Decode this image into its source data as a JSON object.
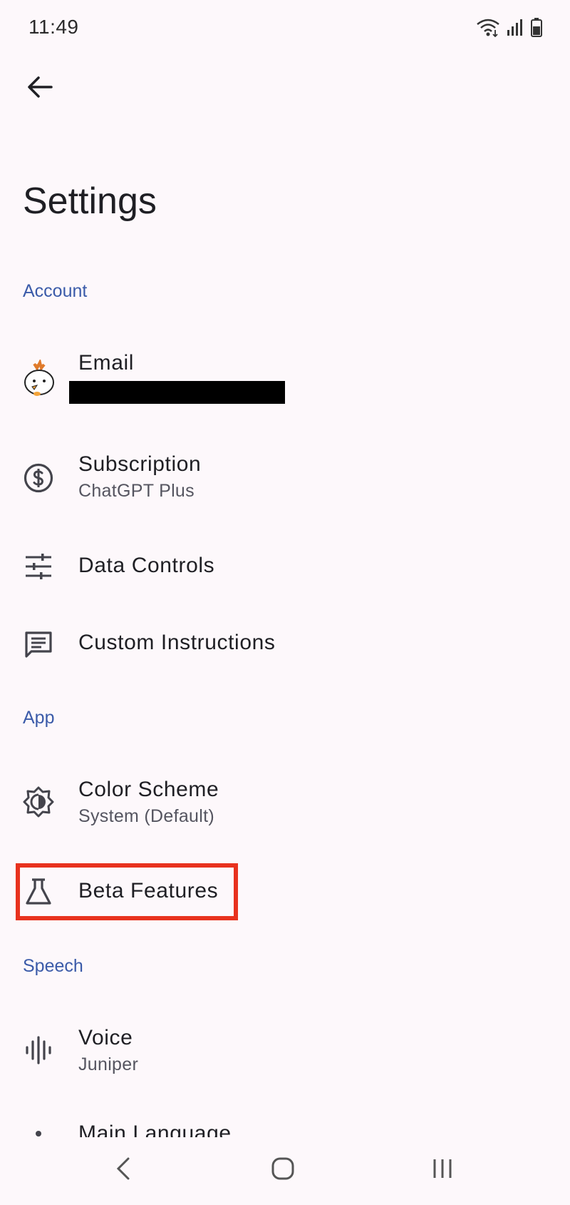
{
  "status_bar": {
    "time": "11:49",
    "icons": [
      "wifi-icon",
      "signal-icon",
      "battery-icon"
    ]
  },
  "header": {
    "back_icon": "arrow-left-icon",
    "title": "Settings"
  },
  "sections": {
    "account": {
      "header": "Account",
      "items": [
        {
          "label": "Email",
          "sub": "",
          "icon": "avatar"
        },
        {
          "label": "Subscription",
          "sub": "ChatGPT Plus",
          "icon": "dollar-circle-icon"
        },
        {
          "label": "Data Controls",
          "sub": "",
          "icon": "sliders-icon"
        },
        {
          "label": "Custom Instructions",
          "sub": "",
          "icon": "message-icon"
        }
      ]
    },
    "app": {
      "header": "App",
      "items": [
        {
          "label": "Color Scheme",
          "sub": "System (Default)",
          "icon": "brightness-icon"
        },
        {
          "label": "Beta Features",
          "sub": "",
          "icon": "flask-icon"
        }
      ]
    },
    "speech": {
      "header": "Speech",
      "items": [
        {
          "label": "Voice",
          "sub": "Juniper",
          "icon": "waveform-icon"
        },
        {
          "label": "Main Language",
          "sub": "",
          "icon": "dot-icon"
        }
      ]
    }
  },
  "colors": {
    "background": "#fdf8fb",
    "section_header": "#3b5ba9",
    "highlight": "#e8321e"
  },
  "nav_bar": {
    "icons": [
      "nav-back-icon",
      "nav-home-icon",
      "nav-recents-icon"
    ]
  }
}
